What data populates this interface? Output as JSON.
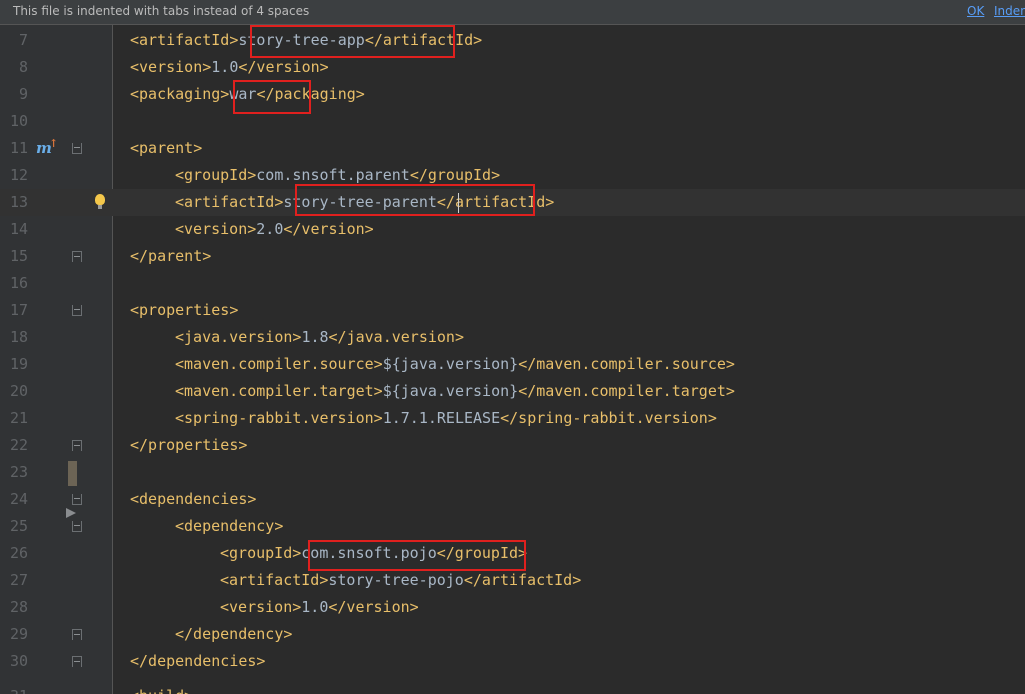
{
  "banner": {
    "message": "This file is indented with tabs instead of 4 spaces",
    "ok_label": "OK",
    "indent_label": "Inden"
  },
  "lines": [
    {
      "num": "7",
      "tag_open": "<artifactId>",
      "text": "story-tree-app",
      "tag_close": "</artifactId>"
    },
    {
      "num": "8",
      "tag_open": "<version>",
      "text": "1.0",
      "tag_close": "</version>"
    },
    {
      "num": "9",
      "tag_open": "<packaging>",
      "text": "war",
      "tag_close": "</packaging>"
    },
    {
      "num": "10",
      "tag_open": "",
      "text": "",
      "tag_close": ""
    },
    {
      "num": "11",
      "tag_open": "<parent>",
      "text": "",
      "tag_close": ""
    },
    {
      "num": "12",
      "tag_open": "<groupId>",
      "text": "com.snsoft.parent",
      "tag_close": "</groupId>"
    },
    {
      "num": "13",
      "tag_open": "<artifactId>",
      "text": "story-tree-parent",
      "tag_close": "</artifactId>"
    },
    {
      "num": "14",
      "tag_open": "<version>",
      "text": "2.0",
      "tag_close": "</version>"
    },
    {
      "num": "15",
      "tag_open": "</parent>",
      "text": "",
      "tag_close": ""
    },
    {
      "num": "16",
      "tag_open": "",
      "text": "",
      "tag_close": ""
    },
    {
      "num": "17",
      "tag_open": "<properties>",
      "text": "",
      "tag_close": ""
    },
    {
      "num": "18",
      "tag_open": "<java.version>",
      "text": "1.8",
      "tag_close": "</java.version>"
    },
    {
      "num": "19",
      "tag_open": "<maven.compiler.source>",
      "text": "${java.version}",
      "tag_close": "</maven.compiler.source>"
    },
    {
      "num": "20",
      "tag_open": "<maven.compiler.target>",
      "text": "${java.version}",
      "tag_close": "</maven.compiler.target>"
    },
    {
      "num": "21",
      "tag_open": "<spring-rabbit.version>",
      "text": "1.7.1.RELEASE",
      "tag_close": "</spring-rabbit.version>"
    },
    {
      "num": "22",
      "tag_open": "</properties>",
      "text": "",
      "tag_close": ""
    },
    {
      "num": "23",
      "tag_open": "",
      "text": "",
      "tag_close": ""
    },
    {
      "num": "24",
      "tag_open": "<dependencies>",
      "text": "",
      "tag_close": ""
    },
    {
      "num": "25",
      "tag_open": "<dependency>",
      "text": "",
      "tag_close": ""
    },
    {
      "num": "26",
      "tag_open": "<groupId>",
      "text": "com.snsoft.pojo",
      "tag_close": "</groupId>"
    },
    {
      "num": "27",
      "tag_open": "<artifactId>",
      "text": "story-tree-pojo",
      "tag_close": "</artifactId>"
    },
    {
      "num": "28",
      "tag_open": "<version>",
      "text": "1.0",
      "tag_close": "</version>"
    },
    {
      "num": "29",
      "tag_open": "</dependency>",
      "text": "",
      "tag_close": ""
    },
    {
      "num": "30",
      "tag_open": "</dependencies>",
      "text": "",
      "tag_close": ""
    }
  ],
  "partial_line": {
    "num": "31",
    "text": "<build>"
  },
  "gutter_icons": {
    "maven": "maven-implemented-icon",
    "bulb": "lightbulb-icon"
  },
  "colors": {
    "tag": "#e8bf6a",
    "text": "#a9b7c6",
    "highlight_box": "#e0201e",
    "background": "#2b2b2b"
  }
}
